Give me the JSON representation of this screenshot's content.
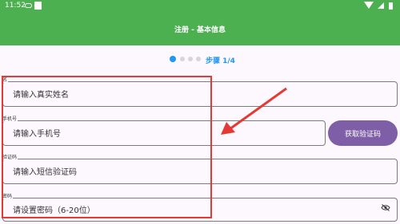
{
  "status_bar": {
    "time": "11:52"
  },
  "app_bar": {
    "title": "注册 - 基本信息"
  },
  "stepper": {
    "label": "步骤 1/4",
    "total_steps": 4,
    "current_step": 1
  },
  "form": {
    "name": {
      "label": "名",
      "placeholder": "请输入真实姓名"
    },
    "phone": {
      "label": "手机号",
      "placeholder": "请输入手机号"
    },
    "code": {
      "label": "验证码",
      "placeholder": "请输入短信验证码"
    },
    "password": {
      "label": "密码",
      "placeholder": "请设置密码（6-20位）"
    },
    "get_code_button": "获取验证码"
  },
  "colors": {
    "primary": "#4caf50",
    "accent": "#2196f3",
    "button": "#7e5ea6",
    "annotation": "#e53935"
  },
  "icons": [
    "visibility-off-icon",
    "wifi-icon",
    "signal-icon",
    "battery-icon"
  ]
}
